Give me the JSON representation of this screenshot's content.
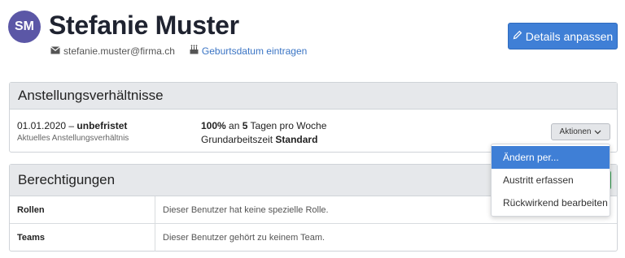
{
  "header": {
    "avatar_initials": "SM",
    "name": "Stefanie Muster",
    "email": "stefanie.muster@firma.ch",
    "birthday_link": "Geburtsdatum eintragen",
    "details_button": "Details anpassen"
  },
  "employment": {
    "title": "Anstellungsverhältnisse",
    "date_start": "01.01.2020",
    "date_sep": " – ",
    "date_end": "unbefristet",
    "subtitle": "Aktuelles Anstellungsverhältnis",
    "pct_value": "100%",
    "pct_mid": " an ",
    "days_value": "5",
    "days_suffix": " Tagen pro Woche",
    "base_label": "Grundarbeitszeit ",
    "base_value": "Standard",
    "actions_button": "Aktionen"
  },
  "permissions": {
    "title": "Berechtigungen",
    "rows": [
      {
        "label": "Rollen",
        "value": "Dieser Benutzer hat keine spezielle Rolle."
      },
      {
        "label": "Teams",
        "value": "Dieser Benutzer gehört zu keinem Team."
      }
    ]
  },
  "actions_menu": {
    "items": [
      "Ändern per...",
      "Austritt erfassen",
      "Rückwirkend bearbeiten"
    ],
    "active_index": 0
  },
  "colors": {
    "primary": "#3f7fd6",
    "avatar": "#5b57a6",
    "success": "#2f9a47"
  },
  "icons": [
    "envelope-icon",
    "cake-icon",
    "pencil-icon",
    "chevron-down-icon"
  ]
}
